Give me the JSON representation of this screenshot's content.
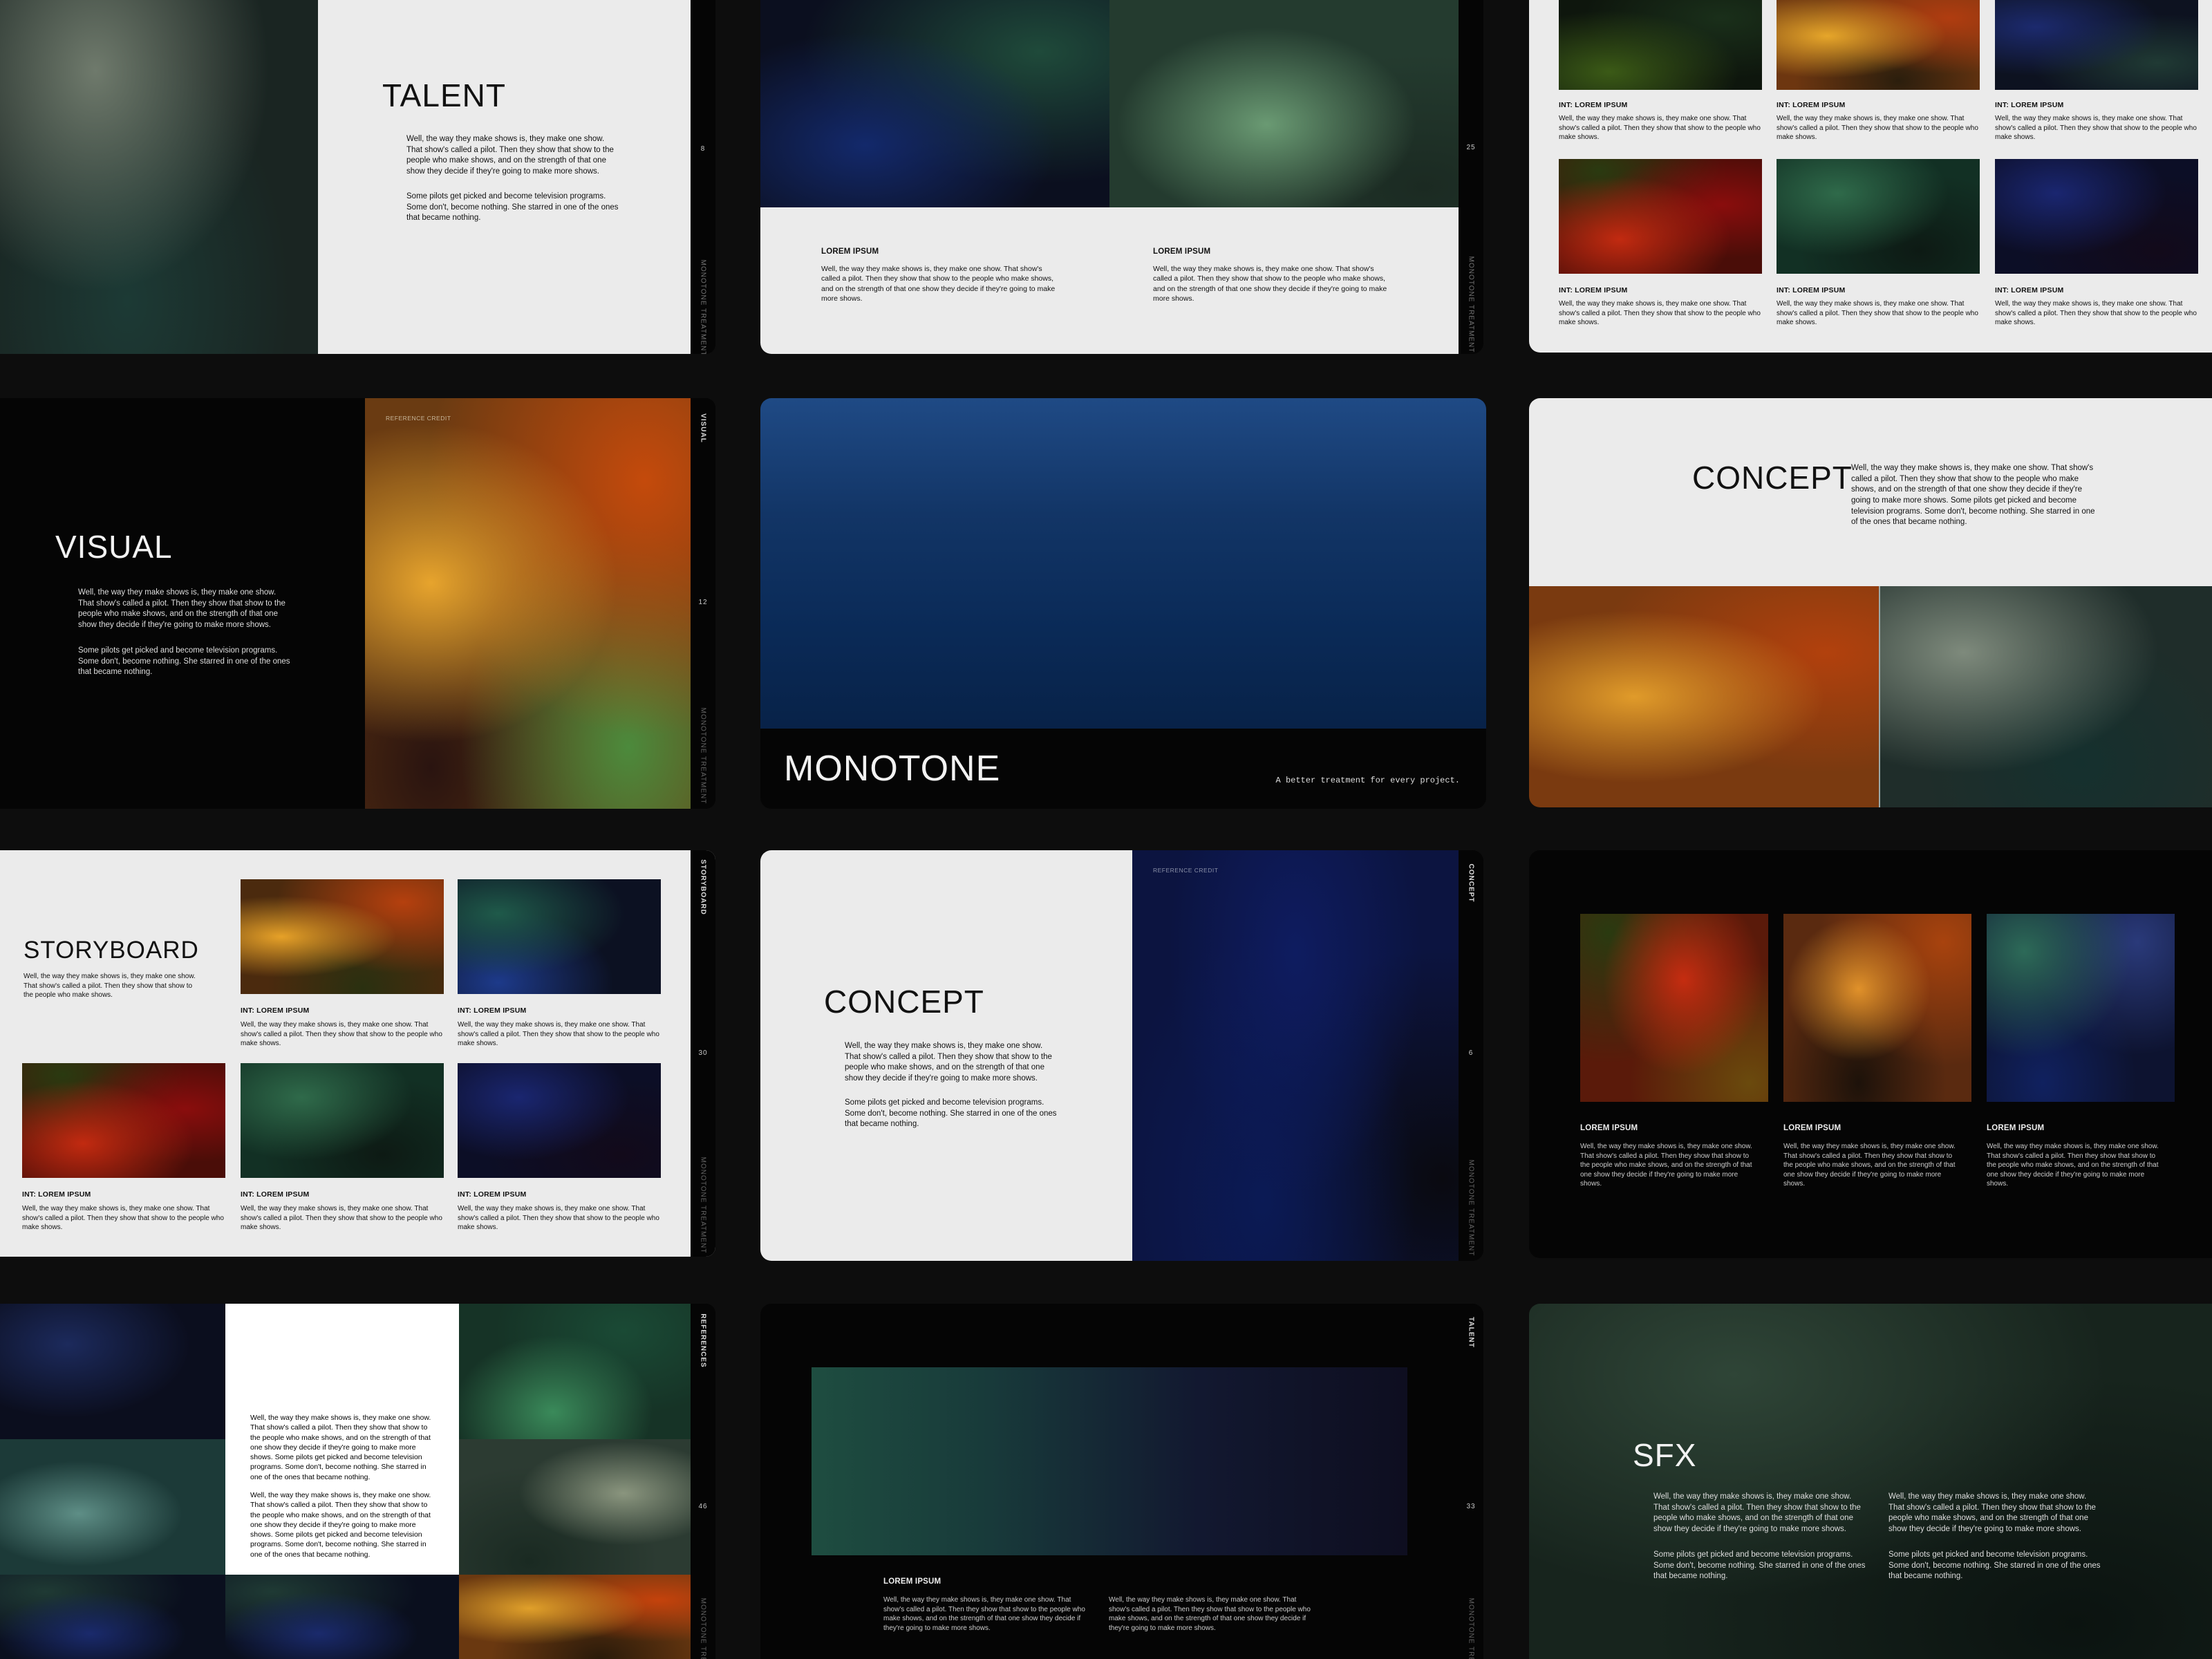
{
  "footer_text": "MONOTONE TREATMENT",
  "reference_credit": "REFERENCE CREDIT",
  "para_long": "Well, the way they make shows is, they make one show. That show's called a pilot. Then they show that show to the people who make shows, and on the strength of that one show they decide if they're going to make more shows.",
  "para_short": "Some pilots get picked and become television programs. Some don't, become nothing. She starred in one of the ones that became nothing.",
  "para_storyboard": "Well, the way they make shows is, they make one show. That show's called a pilot. Then they show that show to the people who make shows.",
  "para_combined": "Well, the way they make shows is, they make one show. That show's called a pilot. Then they show that show to the people who make shows, and on the strength of that one show they decide if they're going to make more shows. Some pilots get picked and become television programs. Some don't, become nothing. She starred in one of the ones that became nothing.",
  "caption_lorem": "LOREM IPSUM",
  "caption_int": "INT: LOREM IPSUM",
  "slides": {
    "talent": {
      "title": "TALENT",
      "page": "8"
    },
    "lorem_grid": {
      "page": "25"
    },
    "visual": {
      "title": "VISUAL",
      "page": "12",
      "side": "VISUAL"
    },
    "cover": {
      "title": "MONOTONE",
      "tagline": "A better treatment for every project."
    },
    "concept_right": {
      "title": "CONCEPT"
    },
    "storyboard": {
      "title": "STORYBOARD",
      "page": "30",
      "side": "STORYBOARD"
    },
    "concept_mid": {
      "title": "CONCEPT",
      "page": "6",
      "side": "CONCEPT"
    },
    "references": {
      "page": "46",
      "side": "REFERENCES"
    },
    "talent_two": {
      "page": "33",
      "side": "TALENT"
    },
    "sfx": {
      "title": "SFX"
    }
  }
}
